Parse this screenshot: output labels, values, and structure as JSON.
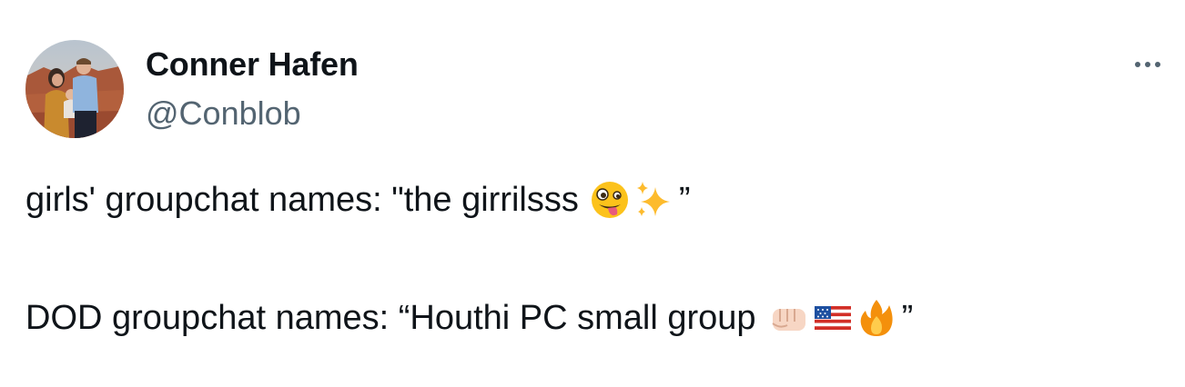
{
  "author": {
    "display_name": "Conner Hafen",
    "handle": "@Conblob"
  },
  "tweet": {
    "line1": {
      "text": "girls' groupchat names: \"the girrilsss",
      "emojis": [
        "zany-face",
        "sparkles"
      ],
      "close_quote": "”"
    },
    "line2": {
      "text": "DOD groupchat names: “Houthi PC small group",
      "emojis": [
        "oncoming-fist-light-skin",
        "us-flag",
        "fire"
      ],
      "close_quote": "”"
    }
  },
  "more_icon": "more-horizontal-icon",
  "colors": {
    "text_primary": "#0f1419",
    "text_secondary": "#536471",
    "background": "#ffffff"
  }
}
